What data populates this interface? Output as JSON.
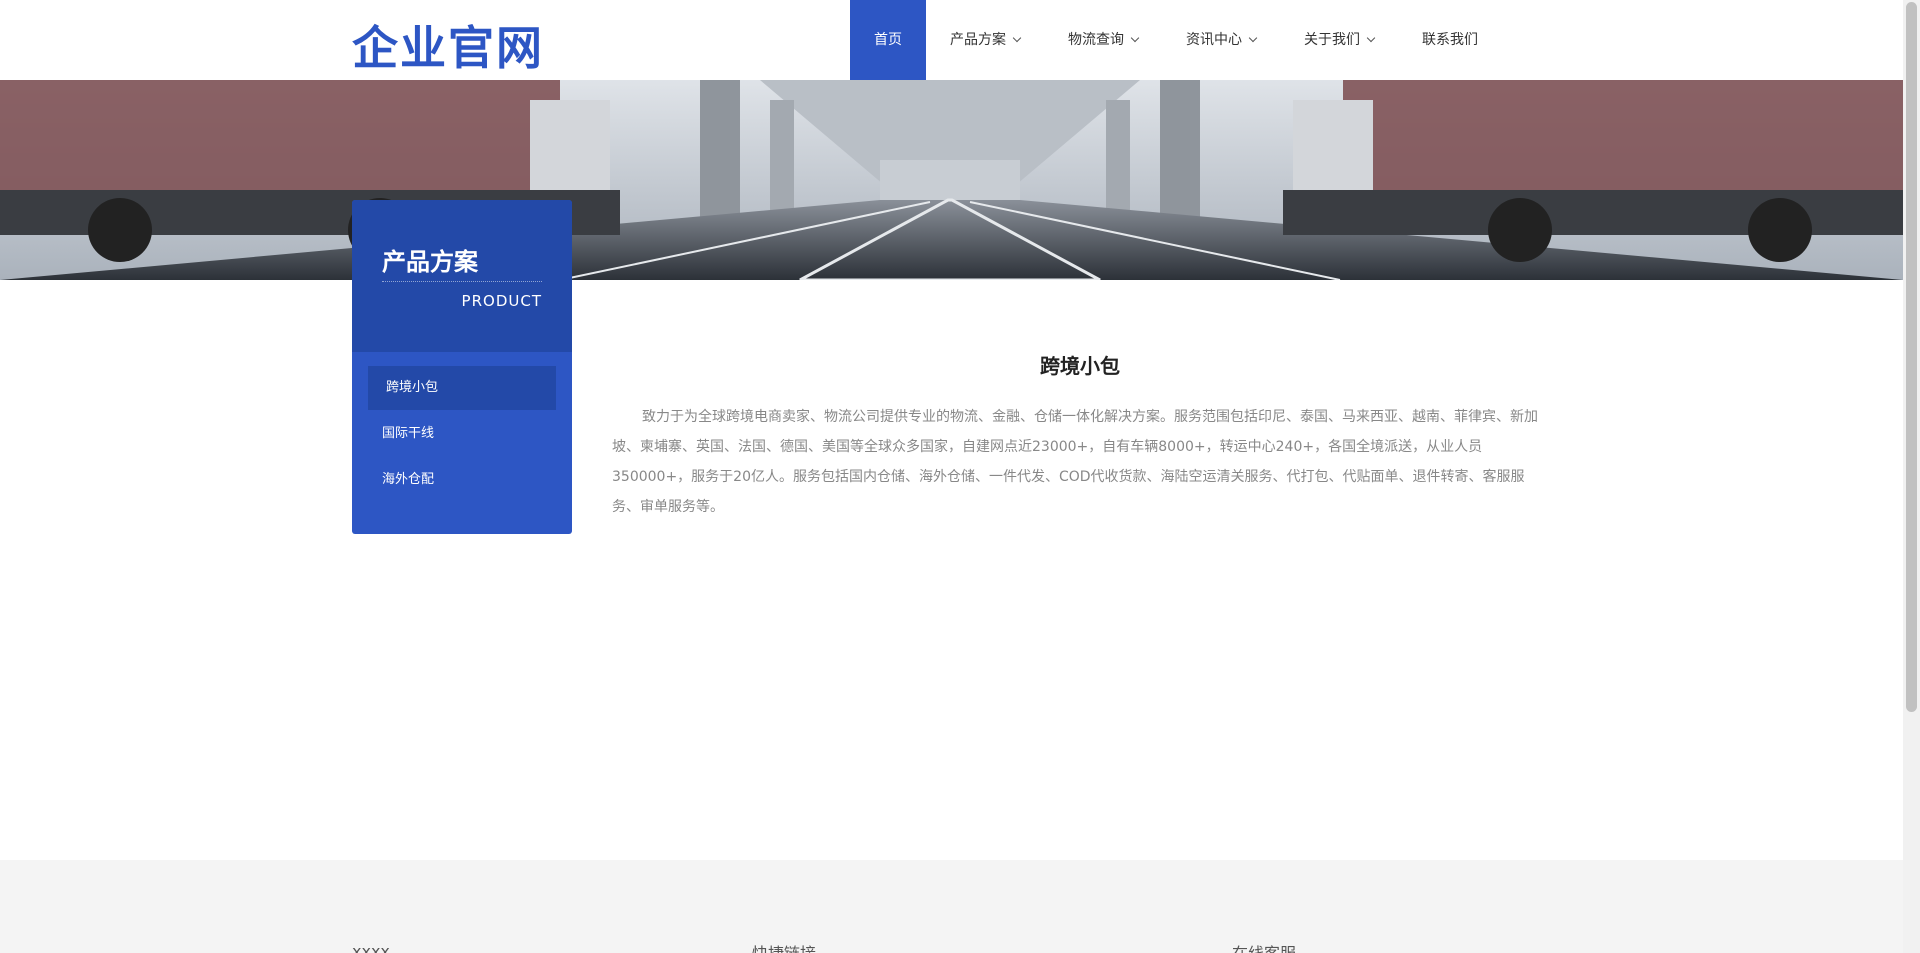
{
  "header": {
    "logo": "企业官网",
    "nav": [
      {
        "label": "首页",
        "dropdown": false,
        "active": true
      },
      {
        "label": "产品方案",
        "dropdown": true
      },
      {
        "label": "物流查询",
        "dropdown": true
      },
      {
        "label": "资讯中心",
        "dropdown": true
      },
      {
        "label": "关于我们",
        "dropdown": true
      },
      {
        "label": "联系我们",
        "dropdown": false
      }
    ]
  },
  "sidebar": {
    "title": "产品方案",
    "subtitle": "PRODUCT",
    "items": [
      {
        "label": "跨境小包",
        "active": true
      },
      {
        "label": "国际干线"
      },
      {
        "label": "海外仓配"
      }
    ]
  },
  "content": {
    "title": "跨境小包",
    "body": "致力于为全球跨境电商卖家、物流公司提供专业的物流、金融、仓储一体化解决方案。服务范围包括印尼、泰国、马来西亚、越南、菲律宾、新加坡、柬埔寨、英国、法国、德国、美国等全球众多国家，自建网点近23000+，自有车辆8000+，转运中心240+，各国全境派送，从业人员350000+，服务于20亿人。服务包括国内仓储、海外仓储、一件代发、COD代收货款、海陆空运清关服务、代打包、代贴面单、退件转寄、客服服务、审单服务等。"
  },
  "footer": {
    "col1": "xxxx",
    "col2": "快捷链接",
    "col3": "在线客服"
  },
  "colors": {
    "primary": "#2d56c4",
    "primary_dark": "#2349a8",
    "footer_bg": "#f4f4f4"
  }
}
